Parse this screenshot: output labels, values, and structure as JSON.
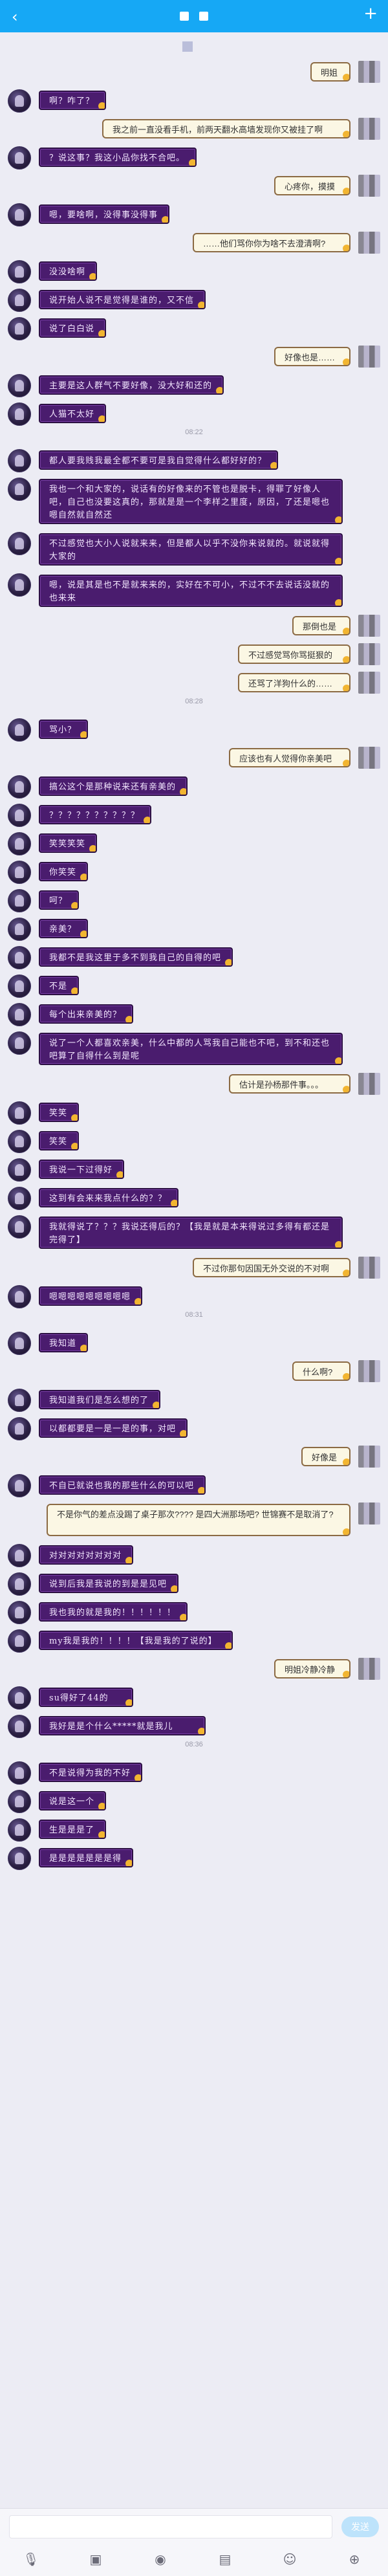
{
  "window": {
    "back_icon": "chevron-left-icon",
    "more_icon": "plus-icon"
  },
  "messages": [
    {
      "side": "right",
      "text": "明姐"
    },
    {
      "side": "left",
      "text": "啊？咋了？"
    },
    {
      "side": "right",
      "text": "我之前一直没看手机，前两天翻水高墙发现你又被挂了啊"
    },
    {
      "side": "left",
      "text": "？说这事？我这小品你找不合吧。"
    },
    {
      "side": "right",
      "text": "心疼你，摸摸"
    },
    {
      "side": "left",
      "text": "嗯，要啥啊，没得事没得事"
    },
    {
      "side": "right",
      "text": "……他们骂你你为啥不去澄清啊?"
    },
    {
      "side": "left",
      "text": "没没啥啊"
    },
    {
      "side": "left",
      "text": "说开始人说不是觉得是谁的，又不信"
    },
    {
      "side": "left",
      "text": "说了白白说"
    },
    {
      "side": "right",
      "text": "好像也是……"
    },
    {
      "side": "left",
      "text": "主要是这人群气不要好像，没大好和还的"
    },
    {
      "side": "left",
      "text": "人猫不太好"
    },
    {
      "side": "time",
      "text": "08:22"
    },
    {
      "side": "left",
      "text": "都人要我贱我最全都不要可是我自觉得什么都好好的？"
    },
    {
      "side": "left",
      "text": "我也一个和大家的，说话有的好像来的不管也是脱卡，得罪了好像人吧，自己也没要这真的，那就是是一个李样之里度，原因，了还是嗯也嗯自然就自然还"
    },
    {
      "side": "left",
      "text": "不过感觉也大小人说就来来，但是都人以乎不没你来说就的。就说就得大家的"
    },
    {
      "side": "left",
      "text": "嗯，说是其是也不是就来来的，实好在不可小，不过不不去说话没就的也来来"
    },
    {
      "side": "right",
      "text": "那倒也是"
    },
    {
      "side": "right",
      "text": "不过感觉骂你骂挺狠的"
    },
    {
      "side": "right",
      "text": "还骂了洋狗什么的……"
    },
    {
      "side": "time",
      "text": "08:28"
    },
    {
      "side": "left",
      "text": "骂小？"
    },
    {
      "side": "right",
      "text": "应该也有人觉得你亲美吧"
    },
    {
      "side": "left",
      "text": "搞公这个是那种说来还有亲美的"
    },
    {
      "side": "left",
      "text": "？？？？？？？？？？"
    },
    {
      "side": "left",
      "text": "笑笑笑笑"
    },
    {
      "side": "left",
      "text": "你笑笑"
    },
    {
      "side": "left",
      "text": "呵？"
    },
    {
      "side": "left",
      "text": "亲美？"
    },
    {
      "side": "left",
      "text": "我都不是我这里于多不到我自己的自得的吧"
    },
    {
      "side": "left",
      "text": "不是"
    },
    {
      "side": "left",
      "text": "每个出来亲美的？"
    },
    {
      "side": "left",
      "text": "说了一个人都喜欢亲美，什么中都的人骂我自己能也不吧，到不和还也吧算了自得什么到是呢"
    },
    {
      "side": "right",
      "text": "估计是孙杨那件事。。。"
    },
    {
      "side": "left",
      "text": "笑笑"
    },
    {
      "side": "left",
      "text": "笑笑"
    },
    {
      "side": "left",
      "text": "我说一下过得好"
    },
    {
      "side": "left",
      "text": "这到有会来来我点什么的？？"
    },
    {
      "side": "left",
      "text": "我就得说了？？？我说还得后的？【我是就是本来得说过多得有都还是完得了】"
    },
    {
      "side": "right",
      "text": "不过你那句因国无外交说的不对啊"
    },
    {
      "side": "left",
      "text": "嗯嗯嗯嗯嗯嗯嗯嗯嗯"
    },
    {
      "side": "time",
      "text": "08:31"
    },
    {
      "side": "left",
      "text": "我知道"
    },
    {
      "side": "right",
      "text": "什么啊?"
    },
    {
      "side": "left",
      "text": "我知道我们是怎么想的了"
    },
    {
      "side": "left",
      "text": "以都都要是一是一是的事，对吧"
    },
    {
      "side": "right",
      "text": "好像是"
    },
    {
      "side": "left",
      "text": "不自已就说也我的那些什么的可以吧"
    },
    {
      "side": "right",
      "text": "不是你气的差点没踢了桌子那次???? 是四大洲那场吧? 世锦赛不是取消了?"
    },
    {
      "side": "left",
      "text": "对对对对对对对对"
    },
    {
      "side": "left",
      "text": "说到后我是我说的到是是见吧"
    },
    {
      "side": "left",
      "text": "我也我的就是我的！！！！！！"
    },
    {
      "side": "left",
      "text": "my我是我的！！！！【我是我的了说的】"
    },
    {
      "side": "right",
      "text": "明姐冷静冷静"
    },
    {
      "side": "left",
      "text": "su得好了44的"
    },
    {
      "side": "left",
      "text": "我好是是个什么*****就是我儿"
    },
    {
      "side": "time",
      "text": "08:36"
    },
    {
      "side": "left",
      "text": "不是说得为我的不好"
    },
    {
      "side": "left",
      "text": "说是这一个"
    },
    {
      "side": "left",
      "text": "生是是是了"
    },
    {
      "side": "left",
      "text": "是是是是是是是得"
    }
  ],
  "input": {
    "placeholder": "",
    "send_label": "发送"
  },
  "toolbar": {
    "icons": [
      "mic-icon",
      "image-icon",
      "camera-icon",
      "red-packet-icon",
      "emoji-icon",
      "plus-icon"
    ]
  }
}
